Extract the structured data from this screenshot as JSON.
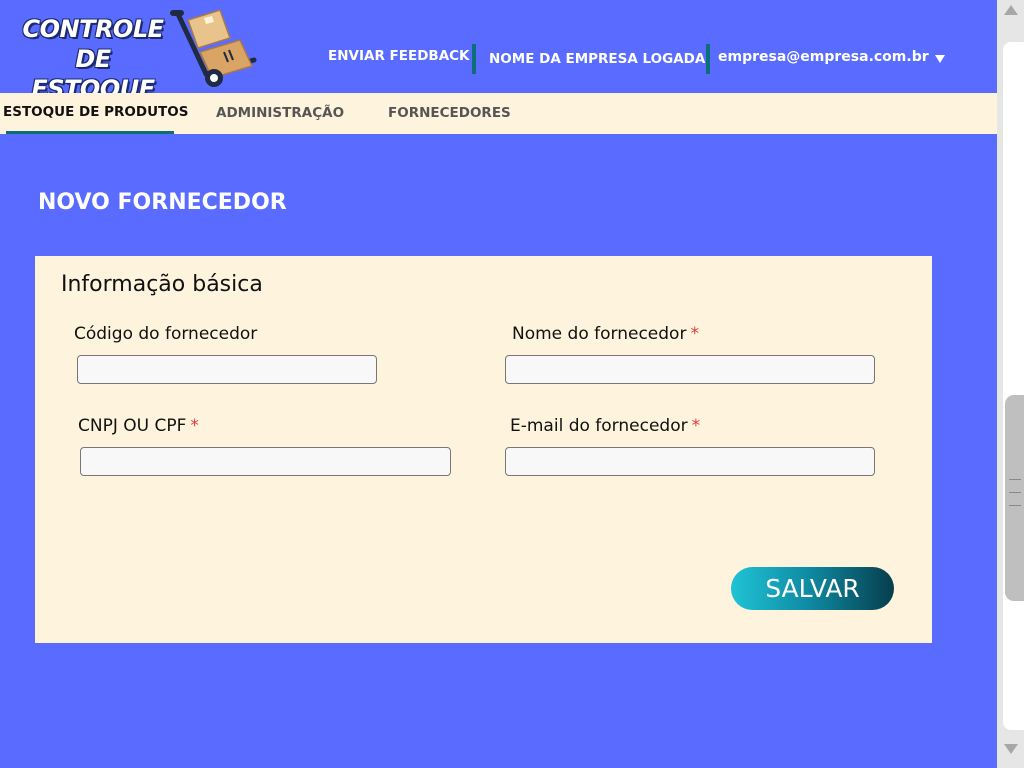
{
  "header": {
    "logo_line1": "CONTROLE DE",
    "logo_line2": "ESTOQUE",
    "feedback": "ENVIAR FEEDBACK",
    "company": "NOME DA EMPRESA LOGADA",
    "email": "empresa@empresa.com.br"
  },
  "tabs": [
    {
      "label": "ESTOQUE DE PRODUTOS",
      "active": true
    },
    {
      "label": "ADMINISTRAÇÃO",
      "active": false
    },
    {
      "label": "FORNECEDORES",
      "active": false
    }
  ],
  "page": {
    "title": "NOVO FORNECEDOR"
  },
  "form": {
    "section_title": "Informação básica",
    "fields": [
      {
        "label": "Código do fornecedor",
        "required": false,
        "value": ""
      },
      {
        "label": "Nome do fornecedor",
        "required": true,
        "value": ""
      },
      {
        "label": "CNPJ OU CPF",
        "required": true,
        "value": ""
      },
      {
        "label": "E-mail do fornecedor",
        "required": true,
        "value": ""
      }
    ],
    "required_mark": "*",
    "save_label": "SALVAR"
  },
  "colors": {
    "background": "#596cff",
    "tabbar": "#fef4dd",
    "accent": "#0c6e76",
    "required": "#e03a3a"
  },
  "icons": {
    "logo": "hand-truck-boxes-icon",
    "email_menu": "caret-down-icon"
  }
}
